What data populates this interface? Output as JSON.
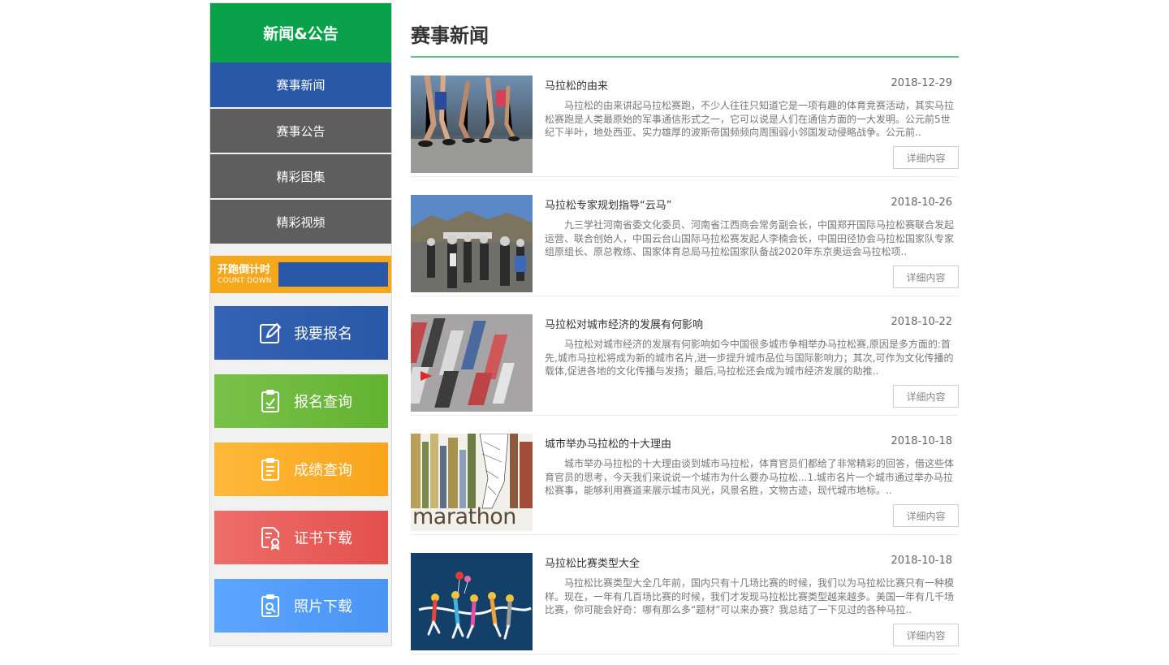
{
  "sidebar": {
    "header": "新闻&公告",
    "nav": [
      {
        "label": "赛事新闻",
        "active": true
      },
      {
        "label": "赛事公告",
        "active": false
      },
      {
        "label": "精彩图集",
        "active": false
      },
      {
        "label": "精彩视频",
        "active": false
      }
    ],
    "countdown": {
      "title": "开跑倒计时",
      "subtitle": "COUNT DOWN"
    },
    "quick_links": [
      {
        "label": "我要报名",
        "icon": "edit-icon",
        "color": "#2a58a8"
      },
      {
        "label": "报名查询",
        "icon": "clipboard-check-icon",
        "color": "#63b232"
      },
      {
        "label": "成绩查询",
        "icon": "score-sheet-icon",
        "color": "#f9a51b"
      },
      {
        "label": "证书下载",
        "icon": "certificate-icon",
        "color": "#e3504c"
      },
      {
        "label": "照片下载",
        "icon": "photo-search-icon",
        "color": "#4a94f4"
      }
    ]
  },
  "main": {
    "title": "赛事新闻",
    "more_label": "详细内容",
    "news": [
      {
        "title": "马拉松的由来",
        "date": "2018-12-29",
        "summary": "马拉松的由来讲起马拉松赛跑，不少人往往只知道它是一项有趣的体育竞赛活动，其实马拉松赛跑是人类最原始的军事通信形式之一，它可以说是人们在通信方面的一大发明。公元前5世纪下半叶，地处西亚、实力雄厚的波斯帝国频频向周围弱小邻国发动侵略战争。公元前..",
        "thumb": "runners-legs"
      },
      {
        "title": "马拉松专家规划指导“云马”",
        "date": "2018-10-26",
        "summary": "九三学社河南省委文化委员、河南省江西商会常务副会长，中国郑开国际马拉松赛联合发起运营、联合创始人，中国云台山国际马拉松赛发起人李楠会长，中国田径协会马拉松国家队专家组原组长、原总教练、国家体育总局马拉松国家队备战2020年东京奥运会马拉松项..",
        "thumb": "mountain-group"
      },
      {
        "title": "马拉松对城市经济的发展有何影响",
        "date": "2018-10-22",
        "summary": "马拉松对城市经济的发展有何影响如今中国很多城市争相举办马拉松赛,原因是多方面的:首先,城市马拉松将成为新的城市名片,进一步提升城市品位与国际影响力；其次,可作为文化传播的载体,促进各地的文化传播与发扬；最后,马拉松还会成为城市经济发展的助推..",
        "thumb": "crowd-blur"
      },
      {
        "title": "城市举办马拉松的十大理由",
        "date": "2018-10-18",
        "summary": "城市举办马拉松的十大理由谈到城市马拉松，体育官员们都给了非常精彩的回答，借这些体育官员的思考，今天我们来说说一个城市为什么要办马拉松...1.城市名片一个城市通过举办马拉松赛事，能够利用赛道来展示城市风光，风景名胜，文物古迹，现代城市地标。..",
        "thumb": "marathon-poster",
        "thumb_text": "marathon"
      },
      {
        "title": "马拉松比赛类型大全",
        "date": "2018-10-18",
        "summary": "马拉松比赛类型大全几年前，国内只有十几场比赛的时候，我们以为马拉松比赛只有一种模样。现在，一年有几百场比赛的时候，我们才发现马拉松比赛类型越来越多。美国一年有几千场比赛，你可能会好奇：哪有那么多“题材”可以来办赛？我总结了一下见过的各种马拉..",
        "thumb": "finish-line-illustration"
      }
    ]
  }
}
